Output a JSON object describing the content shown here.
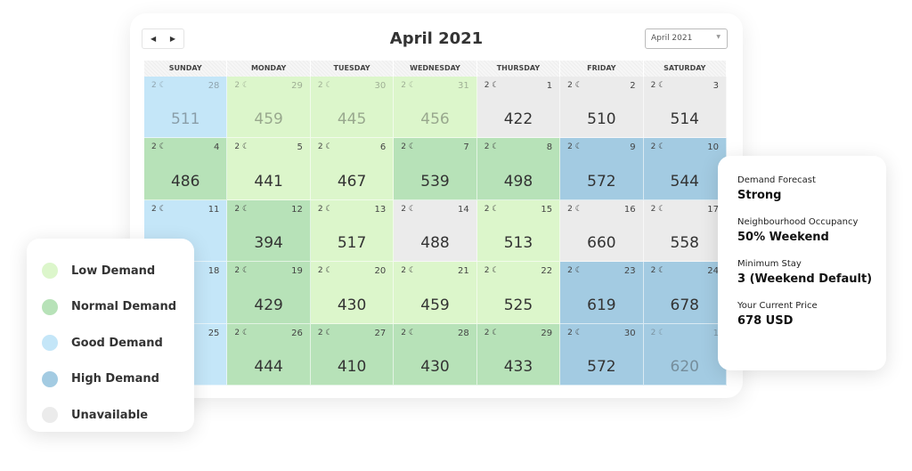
{
  "header": {
    "title": "April 2021",
    "month_select": "April 2021",
    "prev": "◀",
    "next": "▶"
  },
  "colors": {
    "low": "#dcf6cb",
    "normal": "#b7e2b8",
    "good": "#c4e6f8",
    "high": "#a3cbe2",
    "unavailable": "#ebebeb"
  },
  "weekdays": [
    "SUNDAY",
    "MONDAY",
    "TUESDAY",
    "WEDNESDAY",
    "THURSDAY",
    "FRIDAY",
    "SATURDAY"
  ],
  "min_nights_label": "2 ☾",
  "days": [
    {
      "day": "28",
      "price": "511",
      "status": "good",
      "faded": true
    },
    {
      "day": "29",
      "price": "459",
      "status": "low",
      "faded": true
    },
    {
      "day": "30",
      "price": "445",
      "status": "low",
      "faded": true
    },
    {
      "day": "31",
      "price": "456",
      "status": "low",
      "faded": true
    },
    {
      "day": "1",
      "price": "422",
      "status": "unavailable"
    },
    {
      "day": "2",
      "price": "510",
      "status": "unavailable"
    },
    {
      "day": "3",
      "price": "514",
      "status": "unavailable"
    },
    {
      "day": "4",
      "price": "486",
      "status": "normal"
    },
    {
      "day": "5",
      "price": "441",
      "status": "low"
    },
    {
      "day": "6",
      "price": "467",
      "status": "low"
    },
    {
      "day": "7",
      "price": "539",
      "status": "normal"
    },
    {
      "day": "8",
      "price": "498",
      "status": "normal"
    },
    {
      "day": "9",
      "price": "572",
      "status": "high"
    },
    {
      "day": "10",
      "price": "544",
      "status": "high"
    },
    {
      "day": "11",
      "price": "",
      "status": "good"
    },
    {
      "day": "12",
      "price": "394",
      "status": "normal"
    },
    {
      "day": "13",
      "price": "517",
      "status": "low"
    },
    {
      "day": "14",
      "price": "488",
      "status": "unavailable"
    },
    {
      "day": "15",
      "price": "513",
      "status": "low"
    },
    {
      "day": "16",
      "price": "660",
      "status": "unavailable"
    },
    {
      "day": "17",
      "price": "558",
      "status": "unavailable"
    },
    {
      "day": "18",
      "price": "",
      "status": "good"
    },
    {
      "day": "19",
      "price": "429",
      "status": "normal"
    },
    {
      "day": "20",
      "price": "430",
      "status": "low"
    },
    {
      "day": "21",
      "price": "459",
      "status": "low"
    },
    {
      "day": "22",
      "price": "525",
      "status": "low"
    },
    {
      "day": "23",
      "price": "619",
      "status": "high"
    },
    {
      "day": "24",
      "price": "678",
      "status": "high"
    },
    {
      "day": "25",
      "price": "",
      "status": "good"
    },
    {
      "day": "26",
      "price": "444",
      "status": "normal"
    },
    {
      "day": "27",
      "price": "410",
      "status": "normal"
    },
    {
      "day": "28",
      "price": "430",
      "status": "normal"
    },
    {
      "day": "29",
      "price": "433",
      "status": "normal"
    },
    {
      "day": "30",
      "price": "572",
      "status": "high"
    },
    {
      "day": "1",
      "price": "620",
      "status": "high",
      "faded": true
    }
  ],
  "legend": [
    {
      "label": "Low Demand",
      "status": "low"
    },
    {
      "label": "Normal Demand",
      "status": "normal"
    },
    {
      "label": "Good Demand",
      "status": "good"
    },
    {
      "label": "High Demand",
      "status": "high"
    },
    {
      "label": "Unavailable",
      "status": "unavailable"
    }
  ],
  "info": [
    {
      "label": "Demand Forecast",
      "value": "Strong"
    },
    {
      "label": "Neighbourhood Occupancy",
      "value": "50% Weekend"
    },
    {
      "label": "Minimum Stay",
      "value": "3 (Weekend Default)"
    },
    {
      "label": "Your Current Price",
      "value": "678 USD"
    }
  ]
}
